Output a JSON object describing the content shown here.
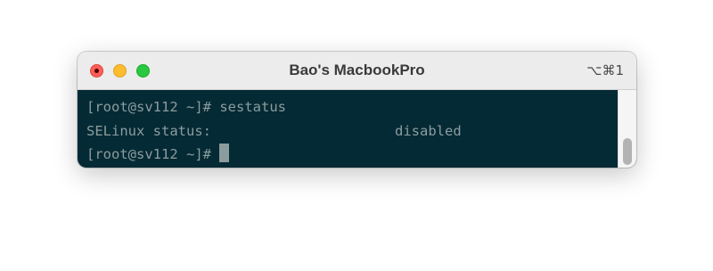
{
  "window": {
    "title": "Bao's MacbookPro",
    "shortcut": "⌥⌘1"
  },
  "terminal": {
    "lines": [
      {
        "prompt": "[root@sv112 ~]#",
        "command": "sestatus"
      },
      {
        "label": "SELinux status:",
        "value": "disabled"
      },
      {
        "prompt": "[root@sv112 ~]#",
        "command": ""
      }
    ]
  },
  "colors": {
    "terminal_bg": "#042a35",
    "terminal_fg": "#8c9c9c",
    "close": "#ff5f57",
    "minimize": "#febc2e",
    "maximize": "#28c840"
  },
  "icons": [
    "close-icon",
    "minimize-icon",
    "maximize-icon"
  ]
}
